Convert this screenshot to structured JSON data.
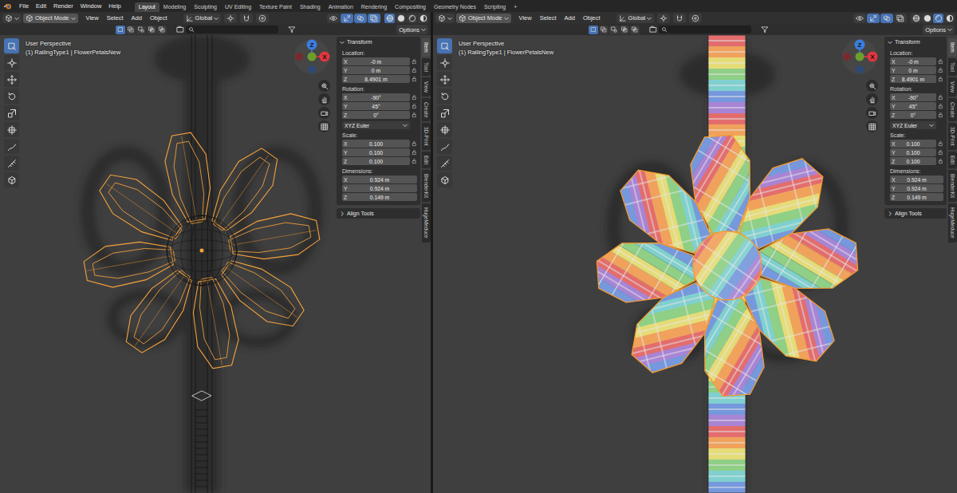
{
  "topbar": {
    "menus": [
      "File",
      "Edit",
      "Render",
      "Window",
      "Help"
    ],
    "workspaces": [
      {
        "label": "Layout",
        "selected": true
      },
      {
        "label": "Modeling",
        "selected": false
      },
      {
        "label": "Sculpting",
        "selected": false
      },
      {
        "label": "UV Editing",
        "selected": false
      },
      {
        "label": "Texture Paint",
        "selected": false
      },
      {
        "label": "Shading",
        "selected": false
      },
      {
        "label": "Animation",
        "selected": false
      },
      {
        "label": "Rendering",
        "selected": false
      },
      {
        "label": "Compositing",
        "selected": false
      },
      {
        "label": "Geometry Nodes",
        "selected": false
      },
      {
        "label": "Scripting",
        "selected": false
      }
    ],
    "add_workspace": "+"
  },
  "viewports": [
    {
      "mode": "Object Mode",
      "menus": [
        "View",
        "Select",
        "Add",
        "Object"
      ],
      "orientation": "Global",
      "xray": true,
      "shading": [
        {
          "kind": "wireframe",
          "selected": true
        },
        {
          "kind": "solid",
          "selected": false
        },
        {
          "kind": "material",
          "selected": false
        },
        {
          "kind": "rendered",
          "selected": false
        }
      ],
      "select_modes": [
        {
          "kind": "set",
          "selected": true
        },
        {
          "kind": "extend",
          "selected": false
        },
        {
          "kind": "subtract",
          "selected": false
        },
        {
          "kind": "difference",
          "selected": false
        },
        {
          "kind": "intersect",
          "selected": false
        }
      ],
      "options": "Options",
      "perspective": "User Perspective",
      "object_info": "(1) RailingType1 | FlowerPetalsNew",
      "tools": [
        {
          "kind": "select",
          "selected": true
        },
        {
          "kind": "cursor",
          "selected": false
        },
        {
          "kind": "move",
          "selected": false
        },
        {
          "kind": "rotate",
          "selected": false
        },
        {
          "kind": "scale",
          "selected": false
        },
        {
          "kind": "transform",
          "selected": false
        },
        {
          "kind": "annotate",
          "selected": false
        },
        {
          "kind": "measure",
          "selected": false
        },
        {
          "kind": "add-cube",
          "selected": false
        }
      ],
      "gizmo": [
        {
          "label": "Z",
          "color": "#3b7ee0"
        },
        {
          "label": "X",
          "color": "#e0363d"
        }
      ],
      "transform": {
        "title": "Transform",
        "groups": [
          {
            "label": "Location:",
            "locks": true,
            "fields": [
              {
                "axis": "X",
                "value": "-0 m"
              },
              {
                "axis": "Y",
                "value": "0 m"
              },
              {
                "axis": "Z",
                "value": "8.4901 m"
              }
            ]
          },
          {
            "label": "Rotation:",
            "locks": true,
            "fields": [
              {
                "axis": "X",
                "value": "-90°"
              },
              {
                "axis": "Y",
                "value": "45°"
              },
              {
                "axis": "Z",
                "value": "0°"
              }
            ],
            "mode": "XYZ Euler"
          },
          {
            "label": "Scale:",
            "locks": true,
            "fields": [
              {
                "axis": "X",
                "value": "0.100"
              },
              {
                "axis": "Y",
                "value": "0.100"
              },
              {
                "axis": "Z",
                "value": "0.100"
              }
            ]
          },
          {
            "label": "Dimensions:",
            "locks": false,
            "fields": [
              {
                "axis": "X",
                "value": "0.924 m"
              },
              {
                "axis": "Y",
                "value": "0.924 m"
              },
              {
                "axis": "Z",
                "value": "0.149 m"
              }
            ]
          }
        ]
      },
      "align_tools": "Align Tools",
      "side_tabs": [
        {
          "label": "Item",
          "selected": true
        },
        {
          "label": "Tool",
          "selected": false
        },
        {
          "label": "View",
          "selected": false
        },
        {
          "label": "Create",
          "selected": false
        },
        {
          "label": "3D-Print",
          "selected": false
        },
        {
          "label": "Edit",
          "selected": false
        },
        {
          "label": "BlenderKit",
          "selected": false
        },
        {
          "label": "HugeMeduce",
          "selected": false
        }
      ]
    },
    {
      "mode": "Object Mode",
      "menus": [
        "View",
        "Select",
        "Add",
        "Object"
      ],
      "orientation": "Global",
      "xray": false,
      "shading": [
        {
          "kind": "wireframe",
          "selected": false
        },
        {
          "kind": "solid",
          "selected": false
        },
        {
          "kind": "material",
          "selected": true
        },
        {
          "kind": "rendered",
          "selected": false
        }
      ],
      "select_modes": [
        {
          "kind": "set",
          "selected": true
        },
        {
          "kind": "extend",
          "selected": false
        },
        {
          "kind": "subtract",
          "selected": false
        },
        {
          "kind": "difference",
          "selected": false
        },
        {
          "kind": "intersect",
          "selected": false
        }
      ],
      "options": "Options",
      "perspective": "User Perspective",
      "object_info": "(1) RailingType1 | FlowerPetalsNew",
      "tools": [
        {
          "kind": "select",
          "selected": true
        },
        {
          "kind": "cursor",
          "selected": false
        },
        {
          "kind": "move",
          "selected": false
        },
        {
          "kind": "rotate",
          "selected": false
        },
        {
          "kind": "scale",
          "selected": false
        },
        {
          "kind": "transform",
          "selected": false
        },
        {
          "kind": "annotate",
          "selected": false
        },
        {
          "kind": "measure",
          "selected": false
        },
        {
          "kind": "add-cube",
          "selected": false
        }
      ],
      "gizmo": [
        {
          "label": "Z",
          "color": "#3b7ee0"
        },
        {
          "label": "X",
          "color": "#e0363d"
        }
      ],
      "transform": {
        "title": "Transform",
        "groups": [
          {
            "label": "Location:",
            "locks": true,
            "fields": [
              {
                "axis": "X",
                "value": "-0 m"
              },
              {
                "axis": "Y",
                "value": "0 m"
              },
              {
                "axis": "Z",
                "value": "8.4901 m"
              }
            ]
          },
          {
            "label": "Rotation:",
            "locks": true,
            "fields": [
              {
                "axis": "X",
                "value": "-90°"
              },
              {
                "axis": "Y",
                "value": "45°"
              },
              {
                "axis": "Z",
                "value": "0°"
              }
            ],
            "mode": "XYZ Euler"
          },
          {
            "label": "Scale:",
            "locks": true,
            "fields": [
              {
                "axis": "X",
                "value": "0.100"
              },
              {
                "axis": "Y",
                "value": "0.100"
              },
              {
                "axis": "Z",
                "value": "0.100"
              }
            ]
          },
          {
            "label": "Dimensions:",
            "locks": false,
            "fields": [
              {
                "axis": "X",
                "value": "0.924 m"
              },
              {
                "axis": "Y",
                "value": "0.924 m"
              },
              {
                "axis": "Z",
                "value": "0.149 m"
              }
            ]
          }
        ]
      },
      "align_tools": "Align Tools",
      "side_tabs": [
        {
          "label": "Item",
          "selected": true
        },
        {
          "label": "Tool",
          "selected": false
        },
        {
          "label": "View",
          "selected": false
        },
        {
          "label": "Create",
          "selected": false
        },
        {
          "label": "3D-Print",
          "selected": false
        },
        {
          "label": "Edit",
          "selected": false
        },
        {
          "label": "BlenderKit",
          "selected": false
        },
        {
          "label": "HugeMeduce",
          "selected": false
        }
      ]
    }
  ]
}
